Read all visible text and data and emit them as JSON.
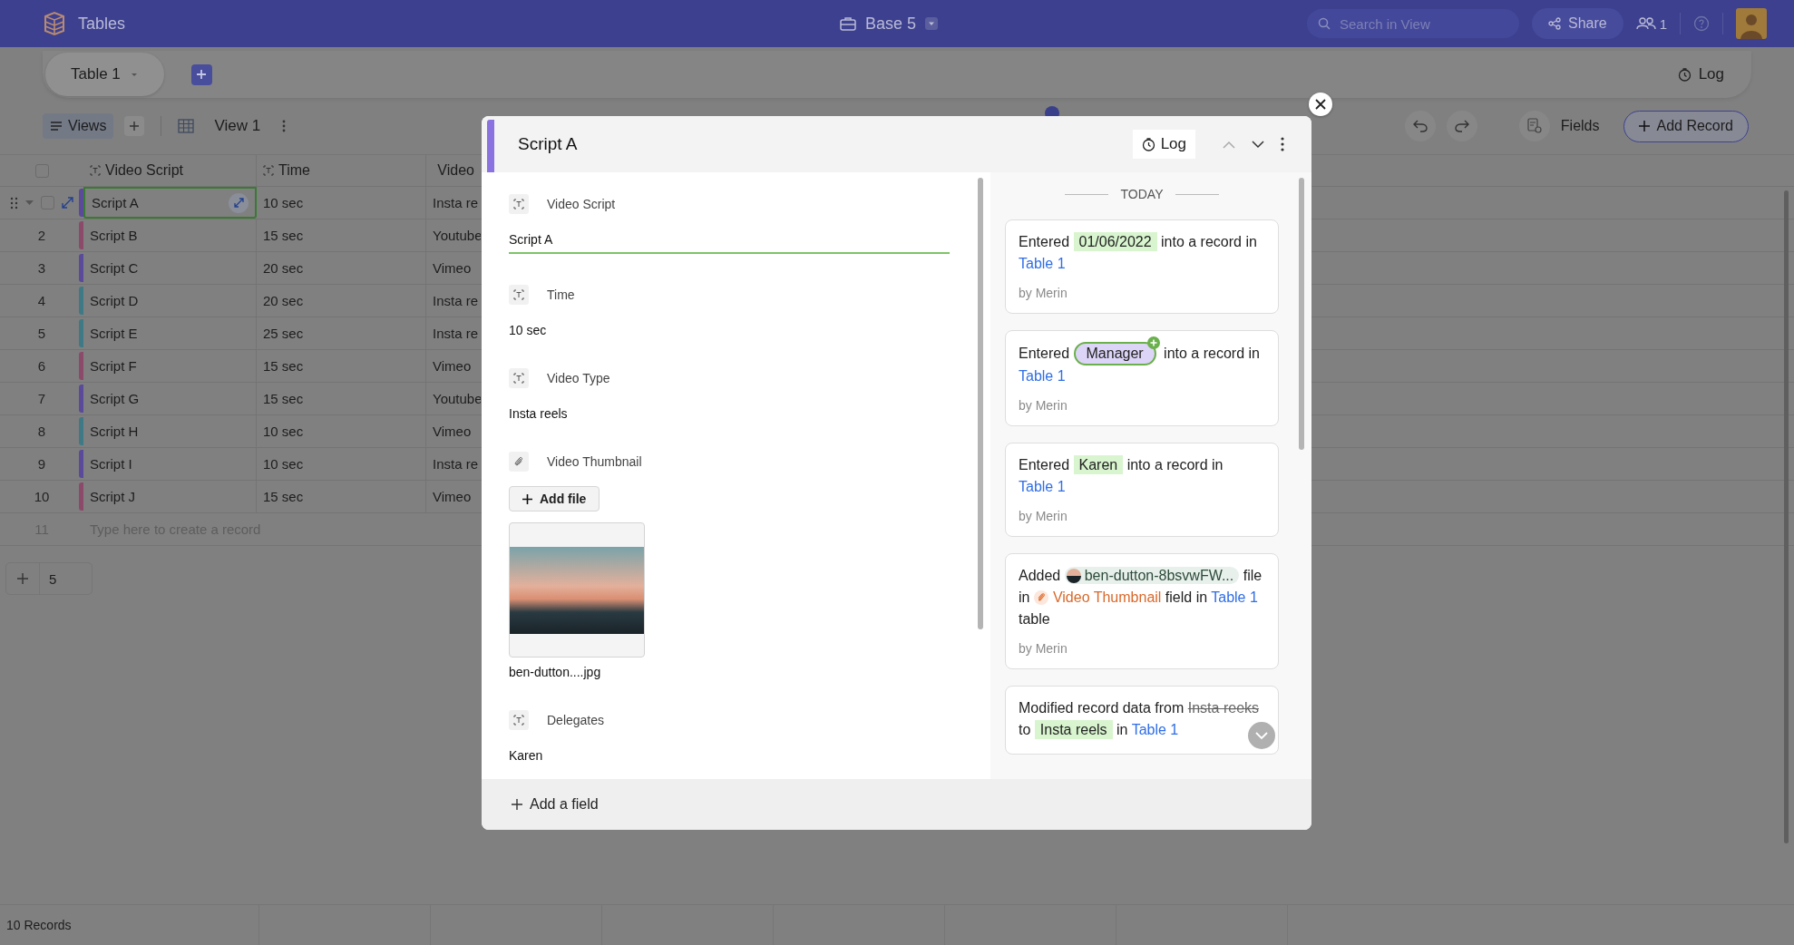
{
  "app": {
    "name": "Tables"
  },
  "base": {
    "title": "Base 5"
  },
  "search": {
    "placeholder": "Search in View"
  },
  "share_button": "Share",
  "collaborators": "1",
  "table_tabs": [
    {
      "label": "Table 1",
      "selected": true
    }
  ],
  "log_button": "Log",
  "toolbar": {
    "views_button": "Views",
    "view_name": "View 1",
    "fields_button": "Fields",
    "add_record_button": "Add Record"
  },
  "table": {
    "columns": [
      "Video Script",
      "Time",
      "Video"
    ],
    "select_all_checked": false,
    "rows": [
      {
        "number": "",
        "name": "Script A",
        "time": "10 sec",
        "type": "Insta re",
        "color": "#5a4a99",
        "selected": true,
        "checked": false
      },
      {
        "number": "2",
        "name": "Script B",
        "time": "15 sec",
        "type": "Youtube",
        "color": "#8c4a6b",
        "selected": false
      },
      {
        "number": "3",
        "name": "Script C",
        "time": "20 sec",
        "type": "Vimeo",
        "color": "#5a4a99",
        "selected": false
      },
      {
        "number": "4",
        "name": "Script D",
        "time": "20 sec",
        "type": "Insta re",
        "color": "#3f7985",
        "selected": false
      },
      {
        "number": "5",
        "name": "Script E",
        "time": "25 sec",
        "type": "Insta re",
        "color": "#3f7985",
        "selected": false
      },
      {
        "number": "6",
        "name": "Script F",
        "time": "15 sec",
        "type": "Vimeo",
        "color": "#8c4a6b",
        "selected": false
      },
      {
        "number": "7",
        "name": "Script G",
        "time": "15 sec",
        "type": "Youtube",
        "color": "#5a4a99",
        "selected": false
      },
      {
        "number": "8",
        "name": "Script H",
        "time": "10 sec",
        "type": "Vimeo",
        "color": "#3f7985",
        "selected": false
      },
      {
        "number": "9",
        "name": "Script I",
        "time": "10 sec",
        "type": "Insta re",
        "color": "#5a4a99",
        "selected": false
      },
      {
        "number": "10",
        "name": "Script J",
        "time": "15 sec",
        "type": "Vimeo",
        "color": "#8c4a6b",
        "selected": false
      }
    ],
    "new_row": {
      "number": "11",
      "placeholder": "Type here to create a record"
    },
    "add_rows_count": "5"
  },
  "status_bar": {
    "records": "10 Records"
  },
  "record": {
    "title": "Script A",
    "log_button": "Log",
    "fields": [
      {
        "kind": "text",
        "label": "Video Script",
        "value": "Script A",
        "focused": true
      },
      {
        "kind": "text",
        "label": "Time",
        "value": "10 sec",
        "focused": false
      },
      {
        "kind": "text",
        "label": "Video Type",
        "value": "Insta reels",
        "focused": false
      },
      {
        "kind": "attachment",
        "label": "Video Thumbnail",
        "button": "Add file",
        "file_name": "ben-dutton....jpg"
      },
      {
        "kind": "text",
        "label": "Delegates",
        "value": "Karen",
        "focused": false
      }
    ],
    "add_field": "Add a field",
    "activity": {
      "day": "TODAY",
      "entries": [
        {
          "parts": [
            {
              "kind": "text",
              "text": "Entered"
            },
            {
              "kind": "chip",
              "text": "01/06/2022"
            },
            {
              "kind": "text",
              "text": "into a record in"
            },
            {
              "kind": "link",
              "text": "Table 1"
            }
          ],
          "author": "by Merin"
        },
        {
          "parts": [
            {
              "kind": "text",
              "text": "Entered"
            },
            {
              "kind": "tag",
              "text": "Manager"
            },
            {
              "kind": "text",
              "text": "into a record in"
            },
            {
              "kind": "link",
              "text": "Table 1"
            }
          ],
          "author": "by Merin"
        },
        {
          "parts": [
            {
              "kind": "text",
              "text": "Entered"
            },
            {
              "kind": "chip",
              "text": "Karen"
            },
            {
              "kind": "text",
              "text": "into a record in"
            },
            {
              "kind": "link",
              "text": "Table 1"
            }
          ],
          "author": "by Merin"
        },
        {
          "parts": [
            {
              "kind": "text",
              "text": "Added"
            },
            {
              "kind": "file",
              "text": "ben-dutton-8bsvwFW..."
            },
            {
              "kind": "text",
              "text": "file in"
            },
            {
              "kind": "field",
              "text": "Video Thumbnail"
            },
            {
              "kind": "text",
              "text": "field in"
            },
            {
              "kind": "link",
              "text": "Table 1"
            },
            {
              "kind": "text",
              "text": "table"
            }
          ],
          "author": "by Merin"
        },
        {
          "parts": [
            {
              "kind": "text",
              "text": "Modified record data from"
            },
            {
              "kind": "strike",
              "text": "Insta reeks"
            },
            {
              "kind": "text",
              "text": "to"
            },
            {
              "kind": "chip",
              "text": "Insta reels"
            },
            {
              "kind": "text",
              "text": "in"
            },
            {
              "kind": "link",
              "text": "Table 1"
            }
          ]
        }
      ]
    }
  }
}
